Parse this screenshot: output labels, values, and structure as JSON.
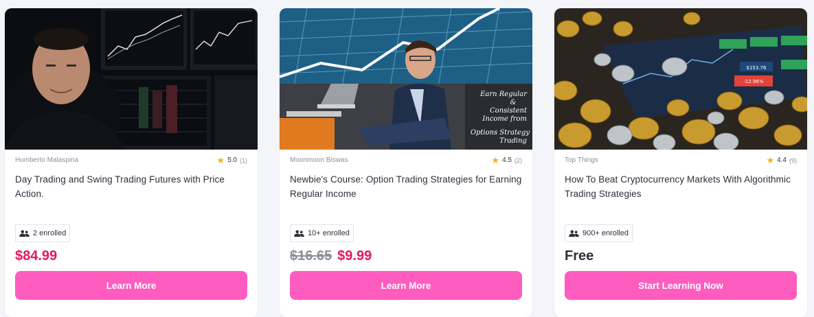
{
  "courses": [
    {
      "instructor": "Humberto Malaspina",
      "rating": "5.0",
      "rating_count": "(1)",
      "title": "Day Trading and Swing Trading Futures with Price Action.",
      "enrolled": "2 enrolled",
      "price": "$84.99",
      "button": "Learn More"
    },
    {
      "instructor": "Moonmoon Biswas",
      "rating": "4.5",
      "rating_count": "(2)",
      "title": "Newbie's Course: Option Trading Strategies for Earning Regular Income",
      "enrolled": "10+ enrolled",
      "price_old": "$16.65",
      "price": "$9.99",
      "button": "Learn More",
      "thumb_text": [
        "Earn Regular",
        "&",
        "Consistent",
        "Income from",
        "Options Strategy",
        "Trading"
      ]
    },
    {
      "instructor": "Top Things",
      "rating": "4.4",
      "rating_count": "(9)",
      "title": "How To Beat Cryptocurrency Markets With Algorithmic Trading Strategies",
      "enrolled": "900+ enrolled",
      "price": "Free",
      "button": "Start Learning Now",
      "thumb_text": [
        "$153.76",
        "-12.96%"
      ]
    }
  ],
  "colors": {
    "accent_button": "#ff5cbf",
    "sale_price": "#e8155d",
    "star": "#f2b01e"
  },
  "icons": {
    "rating": "star-icon",
    "enrolled": "users-icon"
  }
}
